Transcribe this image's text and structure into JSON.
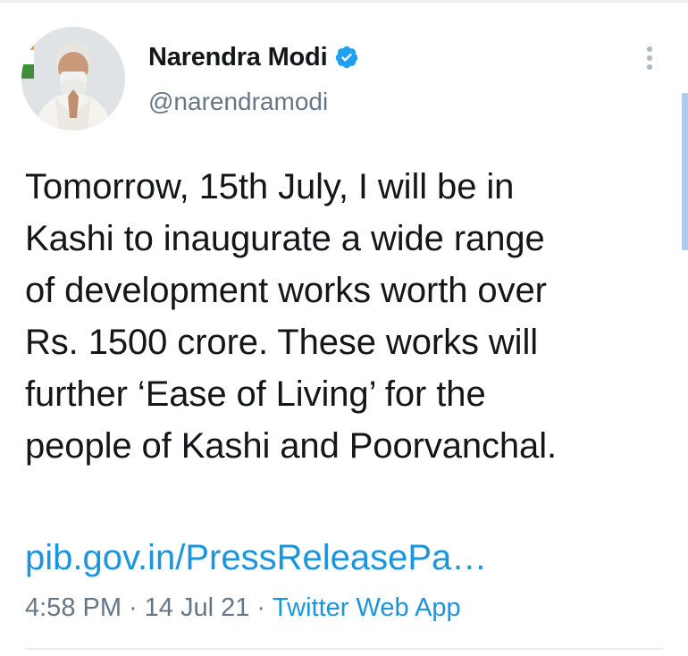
{
  "tweet": {
    "author": {
      "display_name": "Narendra Modi",
      "handle": "@narendramodi",
      "verified": true
    },
    "text": "Tomorrow, 15th July, I will be in\nKashi to inaugurate a wide range\nof development works worth over\nRs. 1500 crore. These works will\nfurther ‘Ease of Living’ for the\npeople of Kashi and Poorvanchal.",
    "link": "pib.gov.in/PressReleasePa…",
    "time": "4:58 PM",
    "date": "14 Jul 21",
    "separator": "·",
    "source": "Twitter Web App"
  },
  "icons": {
    "verified": "verified-badge-icon",
    "more": "more-vertical-icon"
  },
  "colors": {
    "link": "#1b95e0",
    "secondary_text": "#657786",
    "verified": "#1da1f2"
  }
}
